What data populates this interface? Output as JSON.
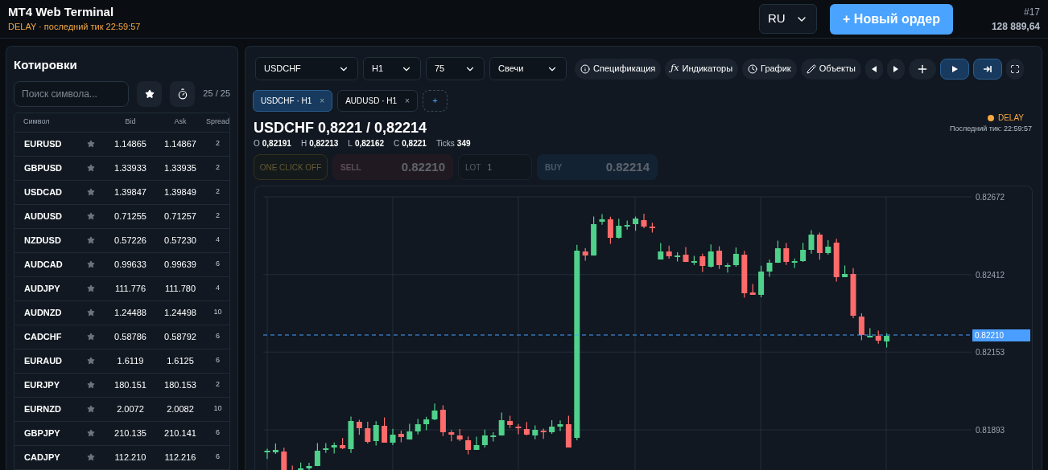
{
  "header": {
    "title": "MT4 Web Terminal",
    "subtitle": "DELAY · последний тик 22:59:57",
    "language": "RU",
    "new_order_button": "+ Новый ордер",
    "account_number": "#17",
    "balance": "128 889,64"
  },
  "quotes": {
    "title": "Котировки",
    "search": {
      "placeholder": "Поиск символа..."
    },
    "count": "25 / 25",
    "columns": [
      "Символ",
      "Bid",
      "Ask",
      "Spread"
    ],
    "rows": [
      {
        "symbol": "EURUSD",
        "favorite": false,
        "bid": "1.14865",
        "ask": "1.14867",
        "spread": "2"
      },
      {
        "symbol": "GBPUSD",
        "favorite": false,
        "bid": "1.33933",
        "ask": "1.33935",
        "spread": "2"
      },
      {
        "symbol": "USDCAD",
        "favorite": false,
        "bid": "1.39847",
        "ask": "1.39849",
        "spread": "2"
      },
      {
        "symbol": "AUDUSD",
        "favorite": false,
        "bid": "0.71255",
        "ask": "0.71257",
        "spread": "2"
      },
      {
        "symbol": "NZDUSD",
        "favorite": false,
        "bid": "0.57226",
        "ask": "0.57230",
        "spread": "4"
      },
      {
        "symbol": "AUDCAD",
        "favorite": false,
        "bid": "0.99633",
        "ask": "0.99639",
        "spread": "6"
      },
      {
        "symbol": "AUDJPY",
        "favorite": false,
        "bid": "111.776",
        "ask": "111.780",
        "spread": "4"
      },
      {
        "symbol": "AUDNZD",
        "favorite": false,
        "bid": "1.24488",
        "ask": "1.24498",
        "spread": "10"
      },
      {
        "symbol": "CADCHF",
        "favorite": false,
        "bid": "0.58786",
        "ask": "0.58792",
        "spread": "6"
      },
      {
        "symbol": "EURAUD",
        "favorite": false,
        "bid": "1.6119",
        "ask": "1.6125",
        "spread": "6"
      },
      {
        "symbol": "EURJPY",
        "favorite": false,
        "bid": "180.151",
        "ask": "180.153",
        "spread": "2"
      },
      {
        "symbol": "EURNZD",
        "favorite": false,
        "bid": "2.0072",
        "ask": "2.0082",
        "spread": "10"
      },
      {
        "symbol": "GBPJPY",
        "favorite": false,
        "bid": "210.135",
        "ask": "210.141",
        "spread": "6"
      },
      {
        "symbol": "CADJPY",
        "favorite": false,
        "bid": "112.210",
        "ask": "112.216",
        "spread": "6"
      }
    ]
  },
  "toolbar": {
    "selects": [
      "USDCHF",
      "H1",
      "75",
      "Свечи"
    ],
    "buttons": [
      {
        "kind": "icon-label",
        "label": "Спецификация",
        "active": false
      },
      {
        "kind": "glyph-label",
        "glyph": "ƒx",
        "label": "Индикаторы",
        "active": false
      },
      {
        "kind": "icon-label",
        "label": "График",
        "active": false
      },
      {
        "kind": "icon-label",
        "label": "Объекты",
        "active": false
      },
      {
        "kind": "icon",
        "active": false
      },
      {
        "kind": "icon",
        "active": false
      },
      {
        "kind": "icon",
        "active": false
      },
      {
        "kind": "icon",
        "active": true
      },
      {
        "kind": "icon",
        "active": true
      },
      {
        "kind": "icon",
        "active": false
      }
    ]
  },
  "chart_tabs": [
    {
      "label": "USDCHF · H1",
      "close": "×",
      "selected": true
    },
    {
      "label": "AUDUSD · H1",
      "close": "×",
      "selected": false
    }
  ],
  "add_tab": "+",
  "instrument": {
    "title": "USDCHF 0,8221 / 0,82214",
    "ohlc": [
      {
        "label": "O",
        "value": "0,82191"
      },
      {
        "label": "H",
        "value": "0,82213"
      },
      {
        "label": "L",
        "value": "0,82162"
      },
      {
        "label": "C",
        "value": "0,8221"
      },
      {
        "label": "Ticks",
        "value": "349"
      }
    ],
    "status": {
      "label": "DELAY",
      "color": "#f5a742",
      "last_tick": "Последний тик: 22:59:57"
    }
  },
  "trade": {
    "one_click": "ONE CLICK OFF",
    "sell_label": "SELL",
    "sell_price": "0.82210",
    "lot_label": "LOT",
    "lot": "1",
    "buy_label": "BUY",
    "buy_price": "0.82214",
    "disabled": true
  },
  "chart": {
    "price_ticks": [
      "0.82672",
      "0.82412",
      "0.82153",
      "0.81893"
    ],
    "current_price": "0.82210"
  }
}
